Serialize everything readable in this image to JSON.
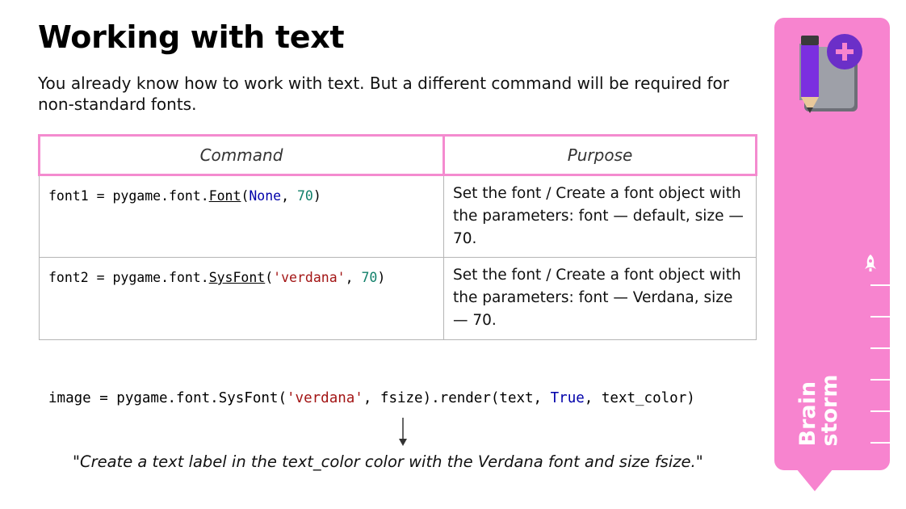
{
  "slide": {
    "title": "Working with text",
    "intro": "You already know how to work with text. But a different command will be required for non-standard fonts."
  },
  "table": {
    "headers": [
      "Command",
      "Purpose"
    ],
    "rows": [
      {
        "code": {
          "prefix": "font1 = pygame.font.",
          "func": "Font",
          "open": "(",
          "arg1": "None",
          "sep": ", ",
          "arg2": "70",
          "close": ")"
        },
        "purpose": "Set the font / Create a font object with the parameters: font — default, size — 70."
      },
      {
        "code": {
          "prefix": "font2 = pygame.font.",
          "func": "SysFont",
          "open": "(",
          "arg1": "'verdana'",
          "sep": ", ",
          "arg2": "70",
          "close": ")"
        },
        "purpose": "Set the font / Create a font object with the parameters: font — Verdana, size — 70."
      }
    ]
  },
  "example": {
    "code_prefix": "image = pygame.font.SysFont(",
    "code_str": "'verdana'",
    "code_mid": ", fsize).render(text, ",
    "code_kw": "True",
    "code_suffix": ", text_color)",
    "caption": "\"Create a text label in the text_color color with the Verdana font and size fsize.\""
  },
  "sidebar": {
    "label_line1": "Brain",
    "label_line2": "storm",
    "accent_color": "#f784cf",
    "logo_icon": "pencil-notebook-plus-icon",
    "progress_icon": "rocket-icon"
  }
}
